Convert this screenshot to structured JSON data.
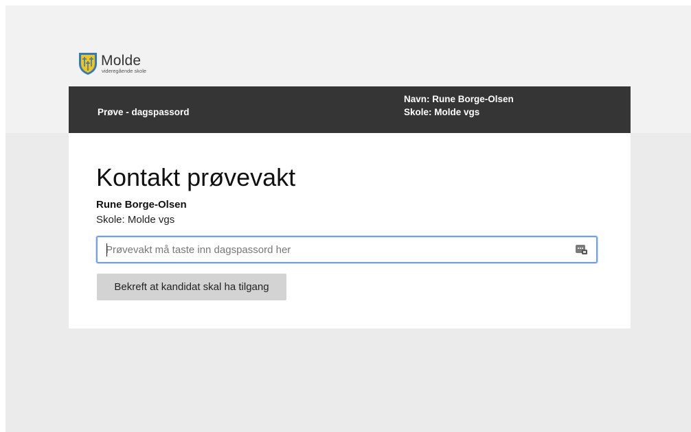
{
  "brand": {
    "name": "Molde",
    "subtitle": "videregående skole",
    "colors": {
      "shield_blue": "#2e7bc4",
      "shield_yellow": "#f2c318"
    }
  },
  "header": {
    "title": "Prøve - dagspassord",
    "user_name": "Navn: Rune Borge-Olsen",
    "school": "Skole: Molde vgs",
    "background": "#353535"
  },
  "main": {
    "heading": "Kontakt prøvevakt",
    "candidate_name": "Rune Borge-Olsen",
    "candidate_school": "Skole: Molde vgs",
    "password_field": {
      "value": "",
      "placeholder": "Prøvevakt må taste inn dagspassord her",
      "icon": "password-manager-key-icon",
      "focus_color": "#6fa0e8"
    },
    "confirm_button": {
      "label": "Bekreft at kandidat skal ha tilgang",
      "background": "#d3d3d3"
    }
  }
}
